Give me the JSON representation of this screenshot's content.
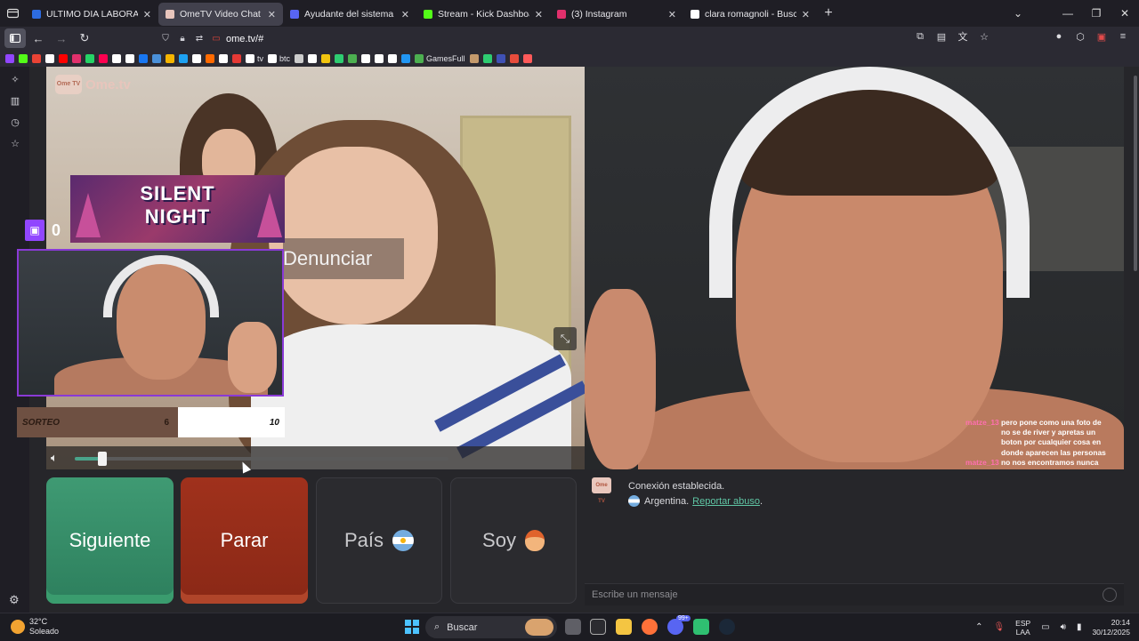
{
  "browser": {
    "tabs": [
      {
        "title": "ULTIMO DIA LABORAL , RESCATE",
        "active": false,
        "favicon_color": "#2d6ce0"
      },
      {
        "title": "OmeTV Video Chat — Ome",
        "active": true,
        "favicon_color": "#e8c5bc"
      },
      {
        "title": "Ayudante del sistema de Discord",
        "active": false,
        "favicon_color": "#5865f2"
      },
      {
        "title": "Stream - Kick Dashboard",
        "active": false,
        "favicon_color": "#53fc18"
      },
      {
        "title": "(3) Instagram",
        "active": false,
        "favicon_color": "#e1306c"
      },
      {
        "title": "clara romagnoli - Buscar con Google",
        "active": false,
        "favicon_color": "#ffffff"
      }
    ],
    "url": "ome.tv/#",
    "bookmarks": [
      {
        "label": "",
        "color": "#9146ff"
      },
      {
        "label": "",
        "color": "#53fc18"
      },
      {
        "label": "",
        "color": "#ea4335"
      },
      {
        "label": "",
        "color": "#ffffff"
      },
      {
        "label": "",
        "color": "#ff0000"
      },
      {
        "label": "",
        "color": "#e1306c"
      },
      {
        "label": "",
        "color": "#25d366"
      },
      {
        "label": "",
        "color": "#ff0050"
      },
      {
        "label": "",
        "color": "#ffffff"
      },
      {
        "label": "",
        "color": "#ffffff"
      },
      {
        "label": "",
        "color": "#1877f2"
      },
      {
        "label": "",
        "color": "#4a90d9"
      },
      {
        "label": "",
        "color": "#f4b400"
      },
      {
        "label": "",
        "color": "#1da1f2"
      },
      {
        "label": "",
        "color": "#ffffff"
      },
      {
        "label": "",
        "color": "#ff6a00"
      },
      {
        "label": "",
        "color": "#ffffff"
      },
      {
        "label": "",
        "color": "#e53935"
      },
      {
        "label": "tv",
        "color": "#ffffff"
      },
      {
        "label": "btc",
        "color": "#ffffff"
      },
      {
        "label": "",
        "color": "#cccccc"
      },
      {
        "label": "",
        "color": "#ffffff"
      },
      {
        "label": "",
        "color": "#f1c40f"
      },
      {
        "label": "",
        "color": "#2ecc71"
      },
      {
        "label": "",
        "color": "#4caf50"
      },
      {
        "label": "",
        "color": "#ffffff"
      },
      {
        "label": "",
        "color": "#ffffff"
      },
      {
        "label": "",
        "color": "#ffffff"
      },
      {
        "label": "",
        "color": "#2196f3"
      },
      {
        "label": "GamesFull",
        "color": "#4caf50"
      },
      {
        "label": "",
        "color": "#c49a6c"
      },
      {
        "label": "",
        "color": "#2ecc71"
      },
      {
        "label": "",
        "color": "#3f51b5"
      },
      {
        "label": "",
        "color": "#e74c3c"
      },
      {
        "label": "",
        "color": "#ff5a5a"
      }
    ]
  },
  "ometv": {
    "logo_text": "Ome.tv",
    "logo_badge": "Ome TV",
    "report_button": "Denunciar",
    "overlay": {
      "banner_line1": "SILENT",
      "banner_line2": "NIGHT",
      "twitch_count": "0",
      "sorteo_label": "SORTEO",
      "sorteo_value": "6",
      "sorteo_goal": "10"
    },
    "volume_level": 0.07,
    "buttons": {
      "next": "Siguiente",
      "stop": "Parar",
      "country": "País",
      "gender": "Soy"
    },
    "chat": {
      "status": "Conexión establecida.",
      "country": "Argentina.",
      "report_link": "Reportar abuso",
      "input_placeholder": "Escribe un mensaje"
    },
    "stream_chat": {
      "user": "matze_13",
      "lines": [
        "pero pone como una foto de",
        "no se de river y apretas un",
        "boton por cualquier cosa en",
        "donde aparecen las personas",
        "no nos encontramos nunca"
      ]
    }
  },
  "taskbar": {
    "temperature": "32°C",
    "weather": "Soleado",
    "search_label": "Buscar",
    "lang_line1": "ESP",
    "lang_line2": "LAA",
    "time": "20:14",
    "date": "30/12/2025",
    "notification_count": "99+"
  }
}
